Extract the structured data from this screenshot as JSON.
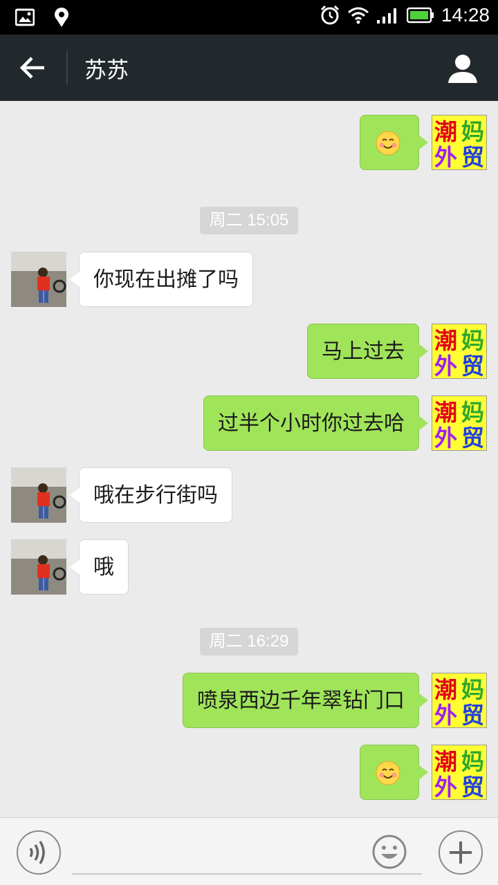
{
  "status_bar": {
    "time": "14:28",
    "icons": [
      "image-notification-icon",
      "location-notification-icon",
      "alarm-icon",
      "wifi-icon",
      "signal-icon",
      "battery-icon"
    ]
  },
  "header": {
    "title": "苏苏",
    "back_icon": "arrow-left-icon",
    "profile_icon": "person-icon"
  },
  "my_avatar": {
    "lines": [
      "潮",
      "妈",
      "外",
      "贸"
    ]
  },
  "messages": [
    {
      "sender": "me",
      "type": "emoji",
      "emoji": "smile-emoji"
    },
    {
      "type": "timestamp",
      "text": "周二 15:05"
    },
    {
      "sender": "them",
      "type": "text",
      "text": "你现在出摊了吗"
    },
    {
      "sender": "me",
      "type": "text",
      "text": "马上过去"
    },
    {
      "sender": "me",
      "type": "text",
      "text": "过半个小时你过去哈"
    },
    {
      "sender": "them",
      "type": "text",
      "text": "哦在步行街吗"
    },
    {
      "sender": "them",
      "type": "text",
      "text": "哦"
    },
    {
      "type": "timestamp",
      "text": "周二 16:29"
    },
    {
      "sender": "me",
      "type": "text",
      "text": "喷泉西边千年翠钻门口"
    },
    {
      "sender": "me",
      "type": "emoji",
      "emoji": "smile-emoji"
    }
  ],
  "input_bar": {
    "placeholder": "",
    "voice_icon": "voice-icon",
    "emoji_icon": "emoji-icon",
    "plus_icon": "plus-icon"
  },
  "colors": {
    "header_bg": "#22292c",
    "chat_bg": "#ebebeb",
    "my_bubble": "#a0e45a",
    "their_bubble": "#ffffff"
  }
}
